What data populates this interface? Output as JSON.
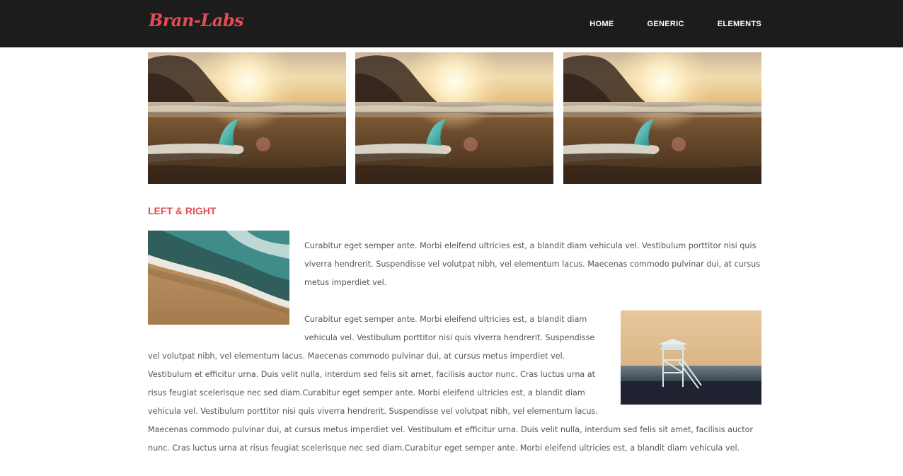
{
  "brand": {
    "name": "Bran-Labs",
    "color": "#e44c55"
  },
  "nav": {
    "items": [
      {
        "label": "HOME"
      },
      {
        "label": "GENERIC"
      },
      {
        "label": "ELEMENTS"
      }
    ]
  },
  "gallery": {
    "images": [
      {
        "subject": "surfboard-on-beach-at-sunset"
      },
      {
        "subject": "surfboard-on-beach-at-sunset"
      },
      {
        "subject": "surfboard-on-beach-at-sunset"
      }
    ]
  },
  "section": {
    "title": "LEFT & RIGHT",
    "paragraph1": "Curabitur eget semper ante. Morbi eleifend ultricies est, a blandit diam vehicula vel. Vestibulum porttitor nisi quis viverra hendrerit. Suspendisse vel volutpat nibh, vel elementum lacus. Maecenas commodo pulvinar dui, at cursus metus imperdiet vel.",
    "paragraph2": "Curabitur eget semper ante. Morbi eleifend ultricies est, a blandit diam vehicula vel. Vestibulum porttitor nisi quis viverra hendrerit. Suspendisse vel volutpat nibh, vel elementum lacus. Maecenas commodo pulvinar dui, at cursus metus imperdiet vel. Vestibulum et efficitur urna. Duis velit nulla, interdum sed felis sit amet, facilisis auctor nunc. Cras luctus urna at risus feugiat scelerisque nec sed diam.Curabitur eget semper ante. Morbi eleifend ultricies est, a blandit diam vehicula vel. Vestibulum porttitor nisi quis viverra hendrerit. Suspendisse vel volutpat nibh, vel elementum lacus. Maecenas commodo pulvinar dui, at cursus metus imperdiet vel. Vestibulum et efficitur urna. Duis velit nulla, interdum sed felis sit amet, facilisis auctor nunc. Cras luctus urna at risus feugiat scelerisque nec sed diam.Curabitur eget semper ante. Morbi eleifend ultricies est, a blandit diam vehicula vel.",
    "left_image": {
      "subject": "ocean-waves-on-sandy-shore"
    },
    "right_image": {
      "subject": "lifeguard-tower-at-dusk"
    }
  },
  "colors": {
    "header_bg": "#1c1c1c",
    "accent": "#e44c55",
    "body_text": "#555555"
  }
}
